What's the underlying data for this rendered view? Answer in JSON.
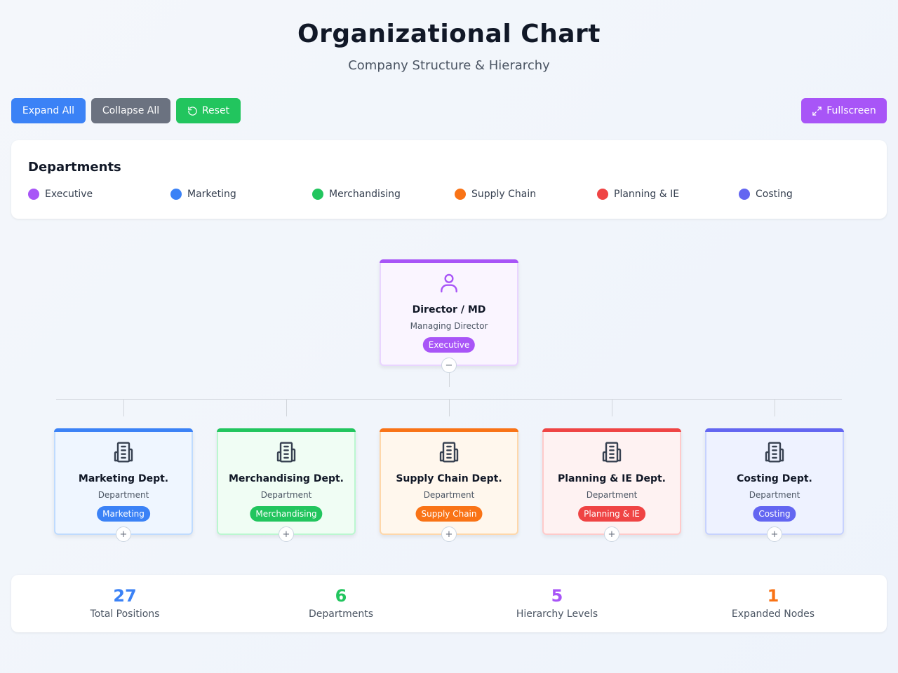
{
  "header": {
    "title": "Organizational Chart",
    "subtitle": "Company Structure & Hierarchy"
  },
  "toolbar": {
    "expand_label": "Expand All",
    "collapse_label": "Collapse All",
    "reset_label": "Reset",
    "fullscreen_label": "Fullscreen"
  },
  "legend": {
    "title": "Departments",
    "items": [
      {
        "label": "Executive",
        "color": "#a855f7"
      },
      {
        "label": "Marketing",
        "color": "#3b82f6"
      },
      {
        "label": "Merchandising",
        "color": "#22c55e"
      },
      {
        "label": "Supply Chain",
        "color": "#f97316"
      },
      {
        "label": "Planning & IE",
        "color": "#ef4444"
      },
      {
        "label": "Costing",
        "color": "#6366f1"
      }
    ]
  },
  "root": {
    "name": "Director / MD",
    "role": "Managing Director",
    "badge": "Executive",
    "toggle": "−",
    "icon": "user-icon",
    "color": "#a855f7",
    "bg": "#faf5ff",
    "border": "#e9d5ff"
  },
  "departments": [
    {
      "name": "Marketing Dept.",
      "role": "Department",
      "badge": "Marketing",
      "toggle": "+",
      "icon": "building-icon",
      "color": "#3b82f6",
      "bg": "#eff6ff",
      "border": "#bfdbfe"
    },
    {
      "name": "Merchandising Dept.",
      "role": "Department",
      "badge": "Merchandising",
      "toggle": "+",
      "icon": "building-icon",
      "color": "#22c55e",
      "bg": "#f0fdf4",
      "border": "#bbf7d0"
    },
    {
      "name": "Supply Chain Dept.",
      "role": "Department",
      "badge": "Supply Chain",
      "toggle": "+",
      "icon": "building-icon",
      "color": "#f97316",
      "bg": "#fff7ed",
      "border": "#fed7aa"
    },
    {
      "name": "Planning & IE Dept.",
      "role": "Department",
      "badge": "Planning & IE",
      "toggle": "+",
      "icon": "building-icon",
      "color": "#ef4444",
      "bg": "#fef2f2",
      "border": "#fecaca"
    },
    {
      "name": "Costing Dept.",
      "role": "Department",
      "badge": "Costing",
      "toggle": "+",
      "icon": "building-icon",
      "color": "#6366f1",
      "bg": "#eef2ff",
      "border": "#c7d2fe"
    }
  ],
  "stats": [
    {
      "value": "27",
      "label": "Total Positions",
      "color": "#3b82f6"
    },
    {
      "value": "6",
      "label": "Departments",
      "color": "#22c55e"
    },
    {
      "value": "5",
      "label": "Hierarchy Levels",
      "color": "#a855f7"
    },
    {
      "value": "1",
      "label": "Expanded Nodes",
      "color": "#f97316"
    }
  ]
}
